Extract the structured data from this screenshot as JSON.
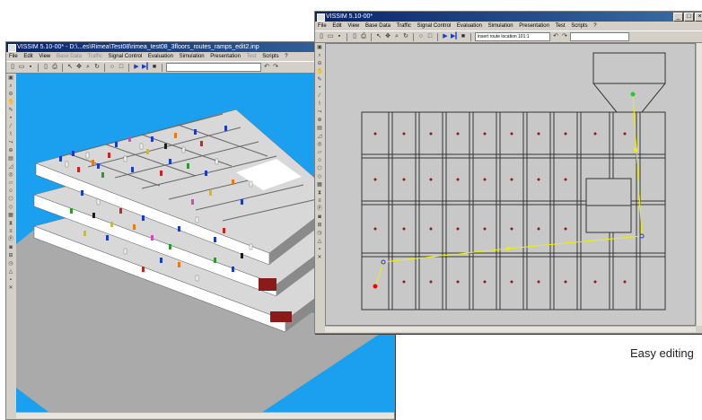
{
  "window_3d": {
    "title": "VISSIM 5.10-00* - D:\\...es\\Rimea\\Test08\\rimea_test08_3floors_routes_ramps_edit2.inp",
    "menu": [
      {
        "label": "File",
        "enabled": true
      },
      {
        "label": "Edit",
        "enabled": true
      },
      {
        "label": "View",
        "enabled": true
      },
      {
        "label": "Base Data",
        "enabled": false
      },
      {
        "label": "Traffic",
        "enabled": false
      },
      {
        "label": "Signal Control",
        "enabled": true
      },
      {
        "label": "Evaluation",
        "enabled": true
      },
      {
        "label": "Simulation",
        "enabled": true
      },
      {
        "label": "Presentation",
        "enabled": true
      },
      {
        "label": "Test",
        "enabled": false
      },
      {
        "label": "Scripts",
        "enabled": true
      },
      {
        "label": "?",
        "enabled": true
      }
    ],
    "viewport_bg": "#1aa0ee"
  },
  "window_2d": {
    "title": "VISSIM 5.10-00*",
    "window_controls": [
      "_",
      "□",
      "×"
    ],
    "menu": [
      {
        "label": "File",
        "enabled": true
      },
      {
        "label": "Edit",
        "enabled": true
      },
      {
        "label": "View",
        "enabled": true
      },
      {
        "label": "Base Data",
        "enabled": true
      },
      {
        "label": "Traffic",
        "enabled": true
      },
      {
        "label": "Signal Control",
        "enabled": true
      },
      {
        "label": "Evaluation",
        "enabled": true
      },
      {
        "label": "Simulation",
        "enabled": true
      },
      {
        "label": "Presentation",
        "enabled": true
      },
      {
        "label": "Test",
        "enabled": true
      },
      {
        "label": "Scripts",
        "enabled": true
      },
      {
        "label": "?",
        "enabled": true
      }
    ],
    "toolbar_input_value": "insert route location 101:1",
    "viewport_bg": "#c8c8c8"
  },
  "caption": "Easy editing",
  "colors": {
    "window_chrome": "#d4d0c8",
    "titlebar_start": "#0a246a",
    "titlebar_end": "#3a6ea5",
    "route_line": "#f0f000",
    "origin_dot": "#ff0000",
    "destination_dot": "#22cc22",
    "room_dot": "#8b1a1a",
    "waypoint": "#2233cc"
  }
}
